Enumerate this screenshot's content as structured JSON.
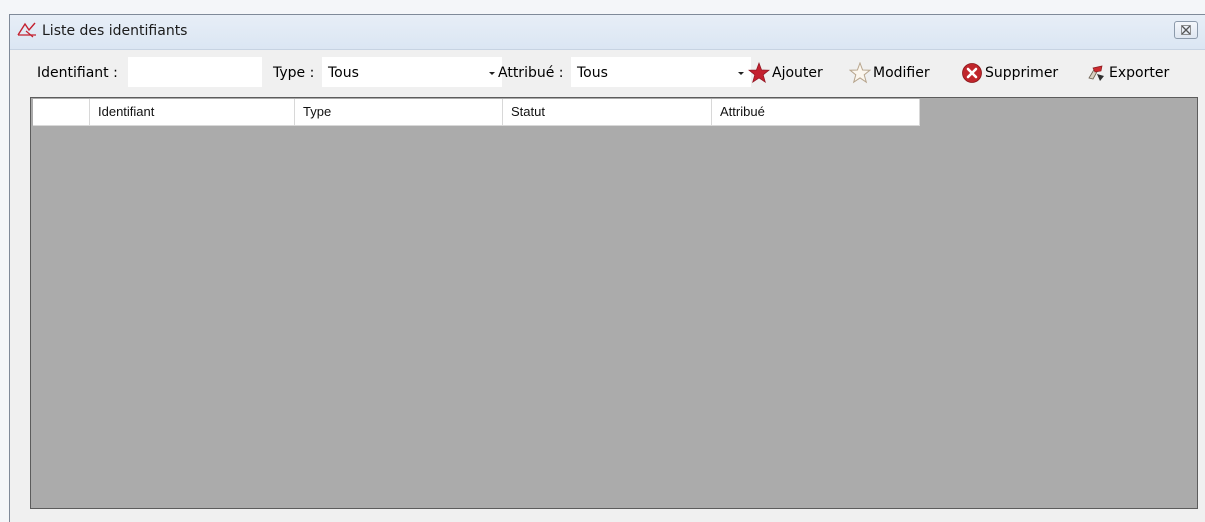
{
  "window": {
    "title": "Liste des identifiants"
  },
  "filters": {
    "identifiant_label": "Identifiant :",
    "identifiant_value": "",
    "type_label": "Type :",
    "type_value": "Tous",
    "attribue_label": "Attribué :",
    "attribue_value": "Tous"
  },
  "toolbar": {
    "add_label": "Ajouter",
    "edit_label": "Modifier",
    "delete_label": "Supprimer",
    "export_label": "Exporter"
  },
  "grid": {
    "columns": [
      "Identifiant",
      "Type",
      "Statut",
      "Attribué"
    ],
    "rows": []
  },
  "colors": {
    "add_star": "#c4202f",
    "delete_icon": "#c0262c",
    "grid_background": "#ababab"
  },
  "icons": {
    "app": "identifiers-app-icon",
    "close": "close-icon",
    "add": "red-star-icon",
    "edit": "outline-star-icon",
    "delete": "red-x-circle-icon",
    "export": "export-icon"
  }
}
